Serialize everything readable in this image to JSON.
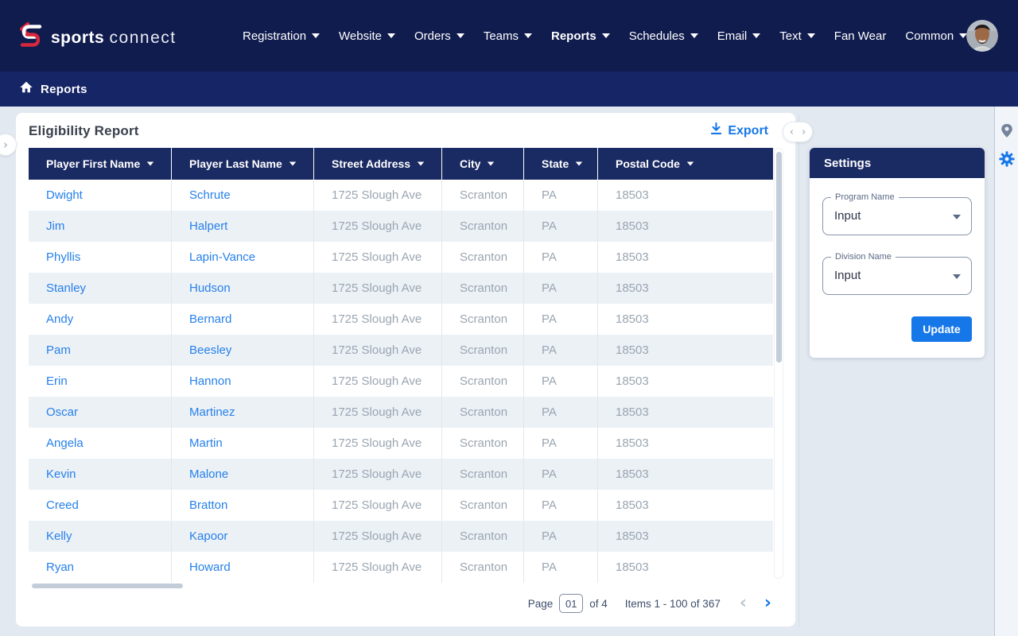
{
  "brand": {
    "bold": "sports",
    "light": "connect"
  },
  "navbar": {
    "items": [
      {
        "label": "Registration",
        "caret": true,
        "active": false
      },
      {
        "label": "Website",
        "caret": true,
        "active": false
      },
      {
        "label": "Orders",
        "caret": true,
        "active": false
      },
      {
        "label": "Teams",
        "caret": true,
        "active": false
      },
      {
        "label": "Reports",
        "caret": true,
        "active": true
      },
      {
        "label": "Schedules",
        "caret": true,
        "active": false
      },
      {
        "label": "Email",
        "caret": true,
        "active": false
      },
      {
        "label": "Text",
        "caret": true,
        "active": false
      },
      {
        "label": "Fan Wear",
        "caret": false,
        "active": false
      },
      {
        "label": "Common",
        "caret": true,
        "active": false
      }
    ]
  },
  "breadcrumb": {
    "label": "Reports"
  },
  "report": {
    "title": "Eligibility Report",
    "export_label": "Export",
    "columns": [
      "Player First Name",
      "Player Last Name",
      "Street Address",
      "City",
      "State",
      "Postal Code"
    ],
    "rows": [
      {
        "first": "Dwight",
        "last": "Schrute",
        "street": "1725 Slough Ave",
        "city": "Scranton",
        "state": "PA",
        "zip": "18503"
      },
      {
        "first": "Jim",
        "last": "Halpert",
        "street": "1725 Slough Ave",
        "city": "Scranton",
        "state": "PA",
        "zip": "18503"
      },
      {
        "first": "Phyllis",
        "last": "Lapin-Vance",
        "street": "1725 Slough Ave",
        "city": "Scranton",
        "state": "PA",
        "zip": "18503"
      },
      {
        "first": "Stanley",
        "last": "Hudson",
        "street": "1725 Slough Ave",
        "city": "Scranton",
        "state": "PA",
        "zip": "18503"
      },
      {
        "first": "Andy",
        "last": "Bernard",
        "street": "1725 Slough Ave",
        "city": "Scranton",
        "state": "PA",
        "zip": "18503"
      },
      {
        "first": "Pam",
        "last": "Beesley",
        "street": "1725 Slough Ave",
        "city": "Scranton",
        "state": "PA",
        "zip": "18503"
      },
      {
        "first": "Erin",
        "last": "Hannon",
        "street": "1725 Slough Ave",
        "city": "Scranton",
        "state": "PA",
        "zip": "18503"
      },
      {
        "first": "Oscar",
        "last": "Martinez",
        "street": "1725 Slough Ave",
        "city": "Scranton",
        "state": "PA",
        "zip": "18503"
      },
      {
        "first": "Angela",
        "last": "Martin",
        "street": "1725 Slough Ave",
        "city": "Scranton",
        "state": "PA",
        "zip": "18503"
      },
      {
        "first": "Kevin",
        "last": "Malone",
        "street": "1725 Slough Ave",
        "city": "Scranton",
        "state": "PA",
        "zip": "18503"
      },
      {
        "first": "Creed",
        "last": "Bratton",
        "street": "1725 Slough Ave",
        "city": "Scranton",
        "state": "PA",
        "zip": "18503"
      },
      {
        "first": "Kelly",
        "last": "Kapoor",
        "street": "1725 Slough Ave",
        "city": "Scranton",
        "state": "PA",
        "zip": "18503"
      },
      {
        "first": "Ryan",
        "last": "Howard",
        "street": "1725 Slough Ave",
        "city": "Scranton",
        "state": "PA",
        "zip": "18503"
      }
    ]
  },
  "pagination": {
    "page_label": "Page",
    "page_value": "01",
    "of_label": "of 4",
    "items_label": "Items 1 - 100 of 367",
    "prev_icon": "‹",
    "next_icon": "›"
  },
  "settings": {
    "title": "Settings",
    "fields": [
      {
        "label": "Program Name",
        "value": "Input"
      },
      {
        "label": "Division Name",
        "value": "Input"
      }
    ],
    "update_label": "Update"
  },
  "floating": {
    "expand_icon": "›",
    "pill_icon": "‹ ›"
  },
  "colors": {
    "navbar": "#101C4E",
    "breadcrumb_bar": "#162566",
    "table_header": "#1A2A63",
    "accent_blue": "#1577E8",
    "link_blue": "#2680EB",
    "muted_text": "#9AA5B1",
    "page_background": "#E3E9F1",
    "logo_red": "#D6283C"
  }
}
